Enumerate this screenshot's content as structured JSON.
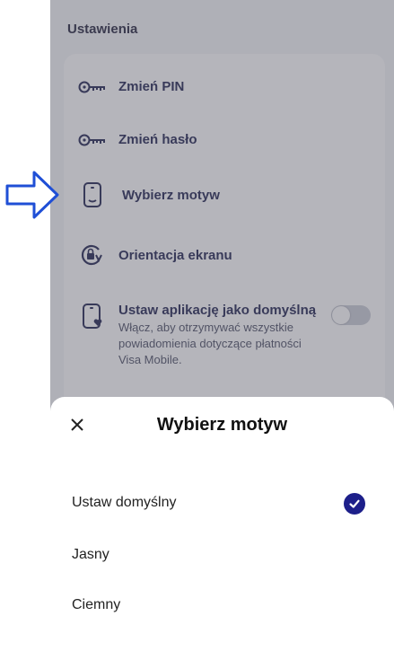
{
  "settings": {
    "section_title": "Ustawienia",
    "items": [
      {
        "label": "Zmień PIN",
        "icon": "key-icon"
      },
      {
        "label": "Zmień hasło",
        "icon": "key-icon"
      },
      {
        "label": "Wybierz motyw",
        "icon": "phone-theme-icon"
      },
      {
        "label": "Orientacja ekranu",
        "icon": "screen-rotation-lock-icon"
      },
      {
        "label": "Ustaw aplikację jako domyślną",
        "icon": "phone-heart-icon",
        "description": "Włącz, aby otrzymywać wszystkie powiadomienia dotyczące płatności Visa Mobile.",
        "toggle": "off"
      }
    ]
  },
  "sheet": {
    "title": "Wybierz motyw",
    "options": [
      {
        "label": "Ustaw domyślny",
        "selected": true
      },
      {
        "label": "Jasny",
        "selected": false
      },
      {
        "label": "Ciemny",
        "selected": false
      }
    ]
  },
  "colors": {
    "primary": "#1d1f8a",
    "pointer_arrow": "#1f4fd6",
    "text_dark": "#1d1f4d"
  }
}
